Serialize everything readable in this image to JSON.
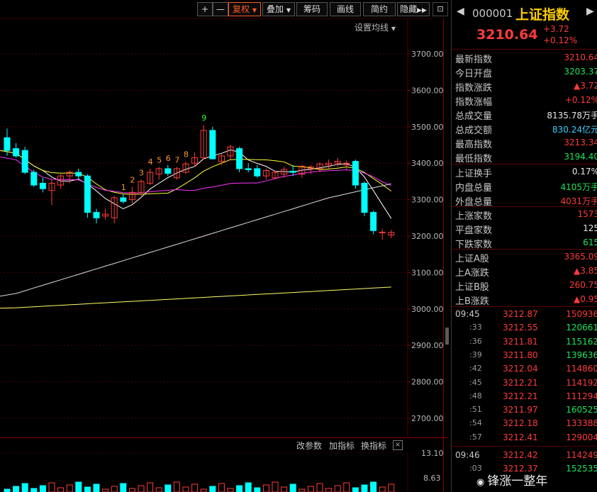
{
  "toolbar": {
    "zoom_in": "+",
    "zoom_out": "—",
    "fq": "复权",
    "overlay": "叠加",
    "chips": "筹码",
    "draw": "画线",
    "simple": "简约",
    "hide": "隐藏",
    "panel_toggle": "⊡"
  },
  "chart": {
    "ma_settings": "设置均线",
    "y_ticks": [
      "3700.00",
      "3600.00",
      "3500.00",
      "3400.00",
      "3300.00",
      "3200.00",
      "3100.00",
      "3000.00",
      "2900.00",
      "2800.00",
      "2700.00"
    ],
    "td_labels": [
      "1",
      "2",
      "3",
      "4",
      "5",
      "6",
      "7",
      "8",
      "9"
    ],
    "colors": {
      "up": "#ff3b3b",
      "down": "#00ffff",
      "ma5": "#ffffff",
      "ma10": "#ffff33",
      "ma20": "#ff33ff",
      "ma60": "#dddddd",
      "ma250": "#ffff66",
      "td": "#ff9933",
      "td9": "#33ff33"
    }
  },
  "chart_data": {
    "type": "candlestick",
    "ylim": [
      2650,
      3750
    ],
    "candles": [
      [
        3470,
        3495,
        3420,
        3435
      ],
      [
        3440,
        3455,
        3415,
        3420
      ],
      [
        3435,
        3445,
        3370,
        3375
      ],
      [
        3375,
        3382,
        3335,
        3340
      ],
      [
        3345,
        3360,
        3320,
        3330
      ],
      [
        3325,
        3355,
        3285,
        3345
      ],
      [
        3340,
        3370,
        3330,
        3365
      ],
      [
        3365,
        3380,
        3345,
        3375
      ],
      [
        3375,
        3385,
        3355,
        3365
      ],
      [
        3365,
        3370,
        3250,
        3265
      ],
      [
        3265,
        3275,
        3235,
        3250
      ],
      [
        3255,
        3275,
        3245,
        3260
      ],
      [
        3250,
        3310,
        3235,
        3305
      ],
      [
        3305,
        3315,
        3290,
        3295
      ],
      [
        3300,
        3335,
        3290,
        3320
      ],
      [
        3320,
        3355,
        3310,
        3350
      ],
      [
        3345,
        3385,
        3340,
        3375
      ],
      [
        3370,
        3390,
        3355,
        3385
      ],
      [
        3385,
        3395,
        3365,
        3372
      ],
      [
        3360,
        3390,
        3355,
        3385
      ],
      [
        3375,
        3405,
        3370,
        3398
      ],
      [
        3400,
        3430,
        3390,
        3415
      ],
      [
        3415,
        3505,
        3410,
        3490
      ],
      [
        3490,
        3500,
        3410,
        3412
      ],
      [
        3405,
        3425,
        3395,
        3420
      ],
      [
        3420,
        3450,
        3410,
        3445
      ],
      [
        3440,
        3445,
        3375,
        3385
      ],
      [
        3385,
        3400,
        3375,
        3382
      ],
      [
        3385,
        3395,
        3360,
        3365
      ],
      [
        3365,
        3385,
        3355,
        3380
      ],
      [
        3360,
        3380,
        3355,
        3375
      ],
      [
        3370,
        3390,
        3360,
        3383
      ],
      [
        3378,
        3395,
        3365,
        3375
      ],
      [
        3370,
        3395,
        3360,
        3392
      ],
      [
        3385,
        3395,
        3370,
        3390
      ],
      [
        3385,
        3402,
        3375,
        3398
      ],
      [
        3395,
        3410,
        3385,
        3400
      ],
      [
        3400,
        3415,
        3390,
        3405
      ],
      [
        3395,
        3408,
        3380,
        3400
      ],
      [
        3405,
        3410,
        3330,
        3340
      ],
      [
        3345,
        3350,
        3255,
        3265
      ],
      [
        3265,
        3270,
        3205,
        3215
      ],
      [
        3210,
        3220,
        3190,
        3211
      ],
      [
        3203,
        3217,
        3194,
        3210
      ]
    ]
  },
  "indicator": {
    "params": "改参数",
    "add": "加指标",
    "switch": "换指标",
    "close": "×",
    "ticks": [
      "13.10",
      "8.63"
    ]
  },
  "quote": {
    "code": "000001",
    "name": "上证指数",
    "price": "3210.64",
    "change": "+3.72",
    "pct": "+0.12%",
    "prev": "◀",
    "next": "▶",
    "rows1": [
      {
        "label": "最新指数",
        "value": "3210.64",
        "cls": "red"
      },
      {
        "label": "今日开盘",
        "value": "3203.37",
        "cls": "green"
      },
      {
        "label": "指数涨跌",
        "value": "▲3.72",
        "cls": "red"
      },
      {
        "label": "指数涨幅",
        "value": "+0.12%",
        "cls": "red"
      },
      {
        "label": "总成交量",
        "value": "8135.78万手",
        "cls": "white"
      },
      {
        "label": "总成交额",
        "value": "830.24亿元",
        "cls": "cyan"
      },
      {
        "label": "最高指数",
        "value": "3213.34",
        "cls": "red"
      },
      {
        "label": "最低指数",
        "value": "3194.40",
        "cls": "green"
      }
    ],
    "rows2": [
      {
        "label": "上证换手",
        "value": "0.17%",
        "cls": "white"
      },
      {
        "label": "内盘总量",
        "value": "4105万手",
        "cls": "green"
      },
      {
        "label": "外盘总量",
        "value": "4031万手",
        "cls": "red"
      }
    ],
    "rows3": [
      {
        "label": "上涨家数",
        "value": "1573",
        "cls": "red"
      },
      {
        "label": "平盘家数",
        "value": "125",
        "cls": "white"
      },
      {
        "label": "下跌家数",
        "value": "615",
        "cls": "green"
      }
    ],
    "rows4": [
      {
        "label": "上证A股",
        "value": "3365.09",
        "cls": "red"
      },
      {
        "label": "上A涨跌",
        "value": "▲3.85",
        "cls": "red"
      },
      {
        "label": "上证B股",
        "value": "260.75",
        "cls": "red"
      },
      {
        "label": "上B涨跌",
        "value": "▲0.95",
        "cls": "red"
      }
    ],
    "ticks": [
      {
        "time": "09:45",
        "price": "3212.87",
        "vol": "150936",
        "pcls": "red",
        "vcls": "red",
        "major": true
      },
      {
        "time": ":33",
        "price": "3212.55",
        "vol": "120661",
        "pcls": "red",
        "vcls": "green"
      },
      {
        "time": ":36",
        "price": "3211.81",
        "vol": "115162",
        "pcls": "red",
        "vcls": "green"
      },
      {
        "time": ":39",
        "price": "3211.80",
        "vol": "139636",
        "pcls": "red",
        "vcls": "green"
      },
      {
        "time": ":42",
        "price": "3212.04",
        "vol": "114860",
        "pcls": "red",
        "vcls": "red"
      },
      {
        "time": ":45",
        "price": "3212.21",
        "vol": "114192",
        "pcls": "red",
        "vcls": "red"
      },
      {
        "time": ":48",
        "price": "3212.21",
        "vol": "111294",
        "pcls": "red",
        "vcls": "red"
      },
      {
        "time": ":51",
        "price": "3211.97",
        "vol": "160525",
        "pcls": "red",
        "vcls": "green"
      },
      {
        "time": ":54",
        "price": "3212.18",
        "vol": "133388",
        "pcls": "red",
        "vcls": "red"
      },
      {
        "time": ":57",
        "price": "3212.41",
        "vol": "129004",
        "pcls": "red",
        "vcls": "red"
      },
      {
        "time": "09:46",
        "price": "3212.42",
        "vol": "114249",
        "pcls": "red",
        "vcls": "red",
        "major": true
      },
      {
        "time": ":03",
        "price": "3212.37",
        "vol": "152535",
        "pcls": "red",
        "vcls": "green"
      }
    ]
  },
  "watermark": "锋涨一整年",
  "watermark_logo": "◉"
}
